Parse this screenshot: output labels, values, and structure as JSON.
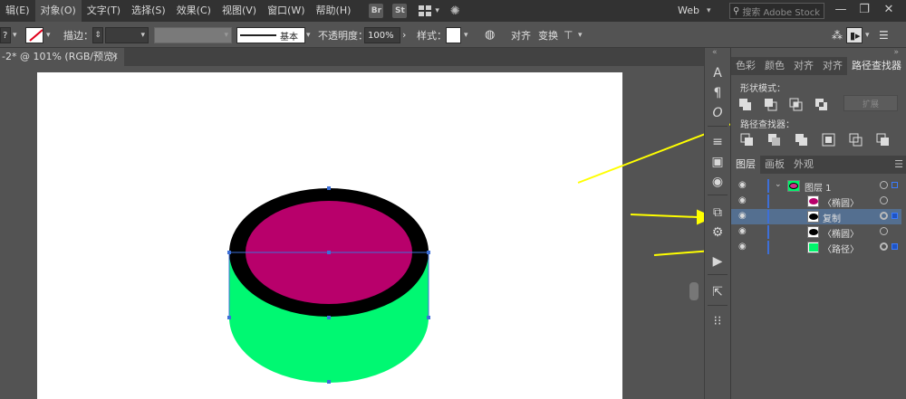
{
  "menu": {
    "items": [
      "辑(E)",
      "对象(O)",
      "文字(T)",
      "选择(S)",
      "效果(C)",
      "视图(V)",
      "窗口(W)",
      "帮助(H)"
    ],
    "app_icons": [
      "Br",
      "St"
    ],
    "workspace": "Web",
    "search_placeholder": "搜索 Adobe Stock",
    "window_controls": [
      "—",
      "❐",
      "✕"
    ]
  },
  "controlbar": {
    "help": "?",
    "stroke_label": "描边：",
    "stroke_style": "基本",
    "opacity_label": "不透明度：",
    "opacity_value": "100%",
    "style_label": "样式：",
    "align_label": "对齐",
    "transform_label": "变换"
  },
  "document": {
    "tab_title": "-2* @ 101% (RGB/预览)",
    "close": "✕"
  },
  "panels": {
    "top_tabs": [
      "色彩",
      "颜色",
      "对齐",
      "对齐",
      "路径查找器"
    ],
    "active_top_tab": "路径查找器",
    "shape_modes_label": "形状模式：",
    "pathfinder_label": "路径查找器：",
    "expand_label": "扩展",
    "layers_tabs": [
      "图层",
      "画板",
      "外观"
    ],
    "layers": [
      {
        "name": "图层 1",
        "swatch": "#d0308a",
        "selected": false
      },
      {
        "name": "〈椭圆〉",
        "swatch": "#b8006b",
        "selected": false
      },
      {
        "name": "复制",
        "swatch": "#000000",
        "selected": true
      },
      {
        "name": "〈椭圆〉",
        "swatch": "#000000",
        "selected": false
      },
      {
        "name": "〈路径〉",
        "swatch": "#00f56b",
        "selected": false
      }
    ]
  },
  "colors": {
    "ellipse_fill": "#b8006b",
    "ring": "#000000",
    "cylinder_body": "#00f872",
    "arrow": "#ffff00",
    "selection": "#3d6fd8"
  }
}
